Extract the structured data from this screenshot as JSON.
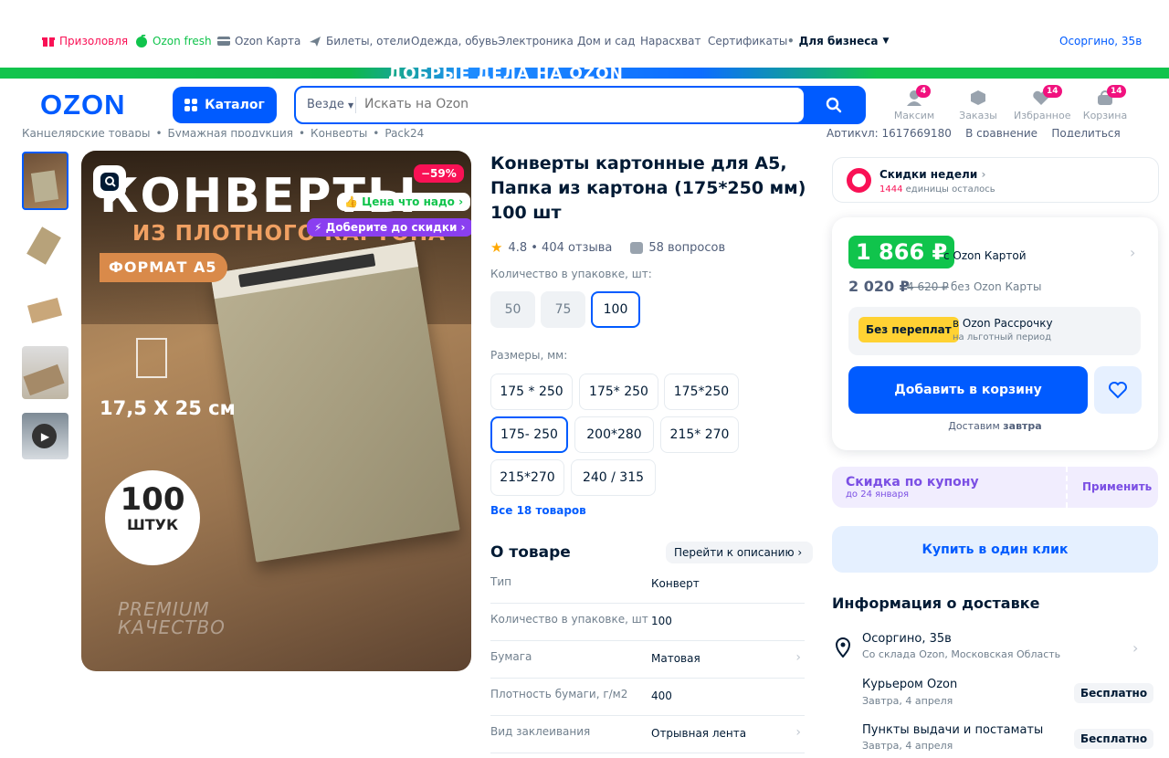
{
  "topnav": {
    "items": [
      {
        "label": "Призоловля",
        "icon": "gift-icon"
      },
      {
        "label": "Ozon fresh",
        "icon": "fresh-icon"
      },
      {
        "label": "Ozon Карта",
        "icon": "card-icon"
      },
      {
        "label": "Билеты, отели",
        "icon": "plane-icon"
      },
      {
        "label": "Одежда, обувь"
      },
      {
        "label": "Электроника"
      },
      {
        "label": "Дом и сад"
      },
      {
        "label": "Нарасхват"
      },
      {
        "label": "Сертификаты"
      },
      {
        "label": "Для бизнеса"
      }
    ],
    "address": "Осоргино, 35в"
  },
  "banner": {
    "text": "ДОБРЫЕ ДЕЛА НА OZON"
  },
  "header": {
    "logo": "OZON",
    "catalog_label": "Каталог",
    "search_scope": "Везде",
    "search_placeholder": "Искать на Ozon",
    "icons": [
      {
        "label": "Максим",
        "badge": "4",
        "icon": "profile-icon"
      },
      {
        "label": "Заказы",
        "badge": "",
        "icon": "orders-box-icon"
      },
      {
        "label": "Избранное",
        "badge": "14",
        "icon": "heart-icon"
      },
      {
        "label": "Корзина",
        "badge": "14",
        "icon": "cart-icon"
      }
    ]
  },
  "breadcrumbs": [
    "Канцелярские товары",
    "•",
    "Бумажная продукция",
    "•",
    "Конверты",
    "•",
    "Pack24"
  ],
  "product_meta": {
    "article": "Артикул: 1617669180",
    "compare": "В сравнение",
    "share": "Поделиться"
  },
  "image": {
    "title": "КОНВЕРТЫ",
    "subtitle": "ИЗ ПЛОТНОГО КАРТОНА",
    "format": "ФОРМАТ А5",
    "size": "17,5 X 25 см",
    "count": "100",
    "count_unit": "ШТУК",
    "premium1": "PREMIUM",
    "premium2": "КАЧЕСТВО",
    "discount": "−59%",
    "tag_price": "Цена что надо",
    "tag_discount": "Доберите до скидки"
  },
  "product": {
    "title": "Конверты картонные для А5, Папка из картона (175*250 мм) 100 шт",
    "rating": "4.8 • 404 отзыва",
    "questions": "58 вопросов",
    "qty_label": "Количество в упаковке, шт:",
    "qty_options": [
      "50",
      "75",
      "100"
    ],
    "qty_selected": "100",
    "size_label": "Размеры, мм:",
    "size_options": [
      "175 * 250",
      "175* 250",
      "175*250",
      "175- 250",
      "200*280",
      "215* 270",
      "215*270",
      "240 / 315"
    ],
    "size_selected": "175- 250",
    "all_products": "Все 18 товаров",
    "about_title": "О товаре",
    "goto_desc": "Перейти к описанию",
    "attributes": [
      {
        "k": "Тип",
        "v": "Конверт",
        "chev": false
      },
      {
        "k": "Количество в упаковке, шт",
        "v": "100",
        "chev": false
      },
      {
        "k": "Бумага",
        "v": "Матовая",
        "chev": true
      },
      {
        "k": "Плотность бумаги, г/м2",
        "v": "400",
        "chev": false
      },
      {
        "k": "Вид заклеивания",
        "v": "Отрывная лента",
        "chev": true
      }
    ]
  },
  "buy": {
    "week_title": "Скидки недели",
    "week_sub_num": "1444",
    "week_sub": "единицы осталось",
    "price_card": "1 866 ₽",
    "price_card_label": "с Ozon Картой",
    "price": "2 020 ₽",
    "price_old": "4 620 ₽",
    "price_label": "без Ozon Карты",
    "rassr_badge": "Без переплат",
    "rassr_title": "в Ozon Рассрочку",
    "rassr_sub": "на льготный период",
    "add_to_cart": "Добавить в корзину",
    "delivery_hint": "Доставим",
    "delivery_hint_bold": "завтра",
    "coupon_title": "Скидка по купону",
    "coupon_sub": "до 24 января",
    "coupon_apply": "Применить",
    "one_click": "Купить в один клик"
  },
  "delivery": {
    "title": "Информация о доставке",
    "address": "Осоргино, 35в",
    "address_sub": "Со склада Ozon, Московская Область",
    "options": [
      {
        "title": "Курьером Ozon",
        "sub": "Завтра, 4 апреля",
        "price": "Бесплатно"
      },
      {
        "title": "Пункты выдачи и постаматы",
        "sub": "Завтра, 4 апреля",
        "price": "Бесплатно"
      }
    ]
  },
  "colors": {
    "brand": "#005bff",
    "green": "#10c44c",
    "pink": "#f91155",
    "yellow": "#ffd233"
  }
}
